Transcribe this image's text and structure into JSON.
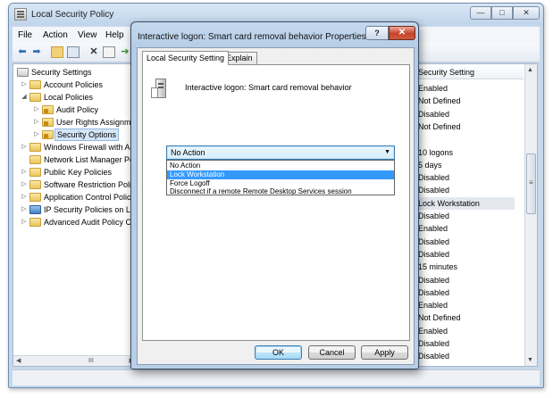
{
  "main_window": {
    "title": "Local Security Policy",
    "controls": {
      "minimize": "—",
      "maximize": "□",
      "close": "✕"
    }
  },
  "menu": {
    "items": [
      "File",
      "Action",
      "View",
      "Help"
    ]
  },
  "toolbar": {
    "icons": [
      "back-icon",
      "forward-icon",
      "up-folder-icon",
      "show-hide-tree-icon",
      "delete-icon",
      "properties-icon",
      "export-icon"
    ]
  },
  "tree": {
    "items": [
      {
        "label": "Security Settings",
        "level": 0,
        "expanded": true
      },
      {
        "label": "Account Policies",
        "level": 1,
        "expanded": false
      },
      {
        "label": "Local Policies",
        "level": 1,
        "expanded": true
      },
      {
        "label": "Audit Policy",
        "level": 2,
        "expanded": false
      },
      {
        "label": "User Rights Assignme",
        "level": 2,
        "expanded": false
      },
      {
        "label": "Security Options",
        "level": 2,
        "selected": true
      },
      {
        "label": "Windows Firewall with Ad",
        "level": 1,
        "expanded": false
      },
      {
        "label": "Network List Manager Po",
        "level": 1
      },
      {
        "label": "Public Key Policies",
        "level": 1,
        "expanded": false
      },
      {
        "label": "Software Restriction Polic",
        "level": 1,
        "expanded": false
      },
      {
        "label": "Application Control Polic",
        "level": 1,
        "expanded": false
      },
      {
        "label": "IP Security Policies on Lo",
        "level": 1,
        "expanded": false
      },
      {
        "label": "Advanced Audit Policy C",
        "level": 1,
        "expanded": false
      }
    ],
    "hscroll_grip": "III"
  },
  "list": {
    "column_header": "Security Setting",
    "values": [
      "Enabled",
      "Not Defined",
      "Disabled",
      "Not Defined",
      "",
      "10 logons",
      "5 days",
      "Disabled",
      "Disabled",
      "Lock Workstation",
      "Disabled",
      "Enabled",
      "Disabled",
      "Disabled",
      "15 minutes",
      "Disabled",
      "Disabled",
      "Enabled",
      "Not Defined",
      "Enabled",
      "Disabled",
      "Disabled"
    ],
    "highlighted_value": "Lock Workstation",
    "scroll_grip": "≡"
  },
  "dialog": {
    "title": "Interactive logon: Smart card removal behavior Properties",
    "help_glyph": "?",
    "close_glyph": "✕",
    "tabs": [
      "Local Security Setting",
      "Explain"
    ],
    "active_tab": "Local Security Setting",
    "policy_name": "Interactive logon: Smart card removal behavior",
    "select_value": "No Action",
    "options": [
      "No Action",
      "Lock Workstation",
      "Force Logoff",
      "Disconnect if a remote Remote Desktop Services session"
    ],
    "highlighted_option": "Lock Workstation",
    "buttons": {
      "ok": "OK",
      "cancel": "Cancel",
      "apply": "Apply"
    }
  }
}
